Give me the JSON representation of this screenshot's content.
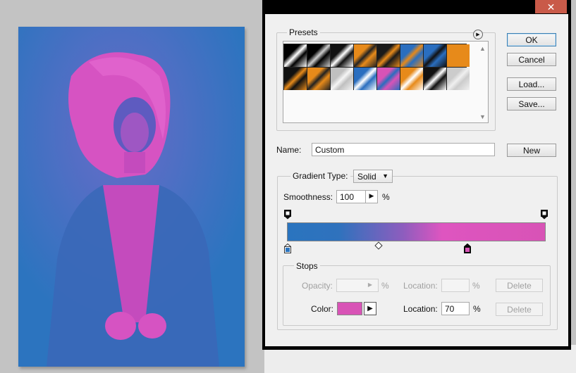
{
  "dialog": {
    "presets_label": "Presets",
    "name_label": "Name:",
    "name_value": "Custom",
    "buttons": {
      "ok": "OK",
      "cancel": "Cancel",
      "load": "Load...",
      "save": "Save...",
      "new": "New"
    },
    "gradient_type_label": "Gradient Type:",
    "gradient_type_value": "Solid",
    "smoothness_label": "Smoothness:",
    "smoothness_value": "100",
    "smoothness_unit": "%",
    "stops": {
      "legend": "Stops",
      "opacity_label": "Opacity:",
      "opacity_unit": "%",
      "opacity_location_label": "Location:",
      "opacity_location_unit": "%",
      "opacity_delete": "Delete",
      "color_label": "Color:",
      "color_location_label": "Location:",
      "color_location_value": "70",
      "color_location_unit": "%",
      "color_delete": "Delete"
    }
  },
  "colors": {
    "stop_color": "#d853b6",
    "gradient_start": "#2a74bf",
    "gradient_end": "#d853b6",
    "ok_border": "#3c7fb1",
    "close_button": "#c95a49"
  },
  "icons": {
    "close": "close-icon",
    "presets_menu": "flyout-menu-icon",
    "dropdown": "chevron-down-icon",
    "stepper": "triangle-right-icon"
  },
  "presets": [
    {
      "colors": [
        "#000000",
        "#ffffff"
      ]
    },
    {
      "colors": [
        "#000000",
        "#cccccc"
      ]
    },
    {
      "colors": [
        "#111111",
        "#ffffff"
      ]
    },
    {
      "colors": [
        "#e78a1a",
        "#222222"
      ]
    },
    {
      "colors": [
        "#1a1a1a",
        "#e78a1a"
      ]
    },
    {
      "colors": [
        "#2a6ebf",
        "#e78a1a"
      ]
    },
    {
      "colors": [
        "#2a6ebf",
        "#111111"
      ]
    },
    {
      "colors": [
        "#e78a1a",
        "#e78a1a"
      ]
    },
    {
      "colors": [
        "#111111",
        "#e78a1a"
      ]
    },
    {
      "colors": [
        "#e78a1a",
        "#222222"
      ]
    },
    {
      "colors": [
        "#c0c0c0",
        "#f5f5f5"
      ]
    },
    {
      "colors": [
        "#2a6ebf",
        "#ffffff"
      ]
    },
    {
      "colors": [
        "#d853b6",
        "#2a6ebf"
      ]
    },
    {
      "colors": [
        "#e78a1a",
        "#ffffff"
      ]
    },
    {
      "colors": [
        "#111111",
        "#ffffff"
      ]
    },
    {
      "colors": [
        "#cccccc",
        "#f0f0f0"
      ]
    }
  ],
  "gradient": {
    "color_stops": [
      {
        "color": "#2a74bf",
        "location": 0
      },
      {
        "color": "#d853b6",
        "location": 70
      }
    ],
    "opacity_stops": [
      {
        "opacity": 100,
        "location": 0
      },
      {
        "opacity": 100,
        "location": 100
      }
    ]
  }
}
